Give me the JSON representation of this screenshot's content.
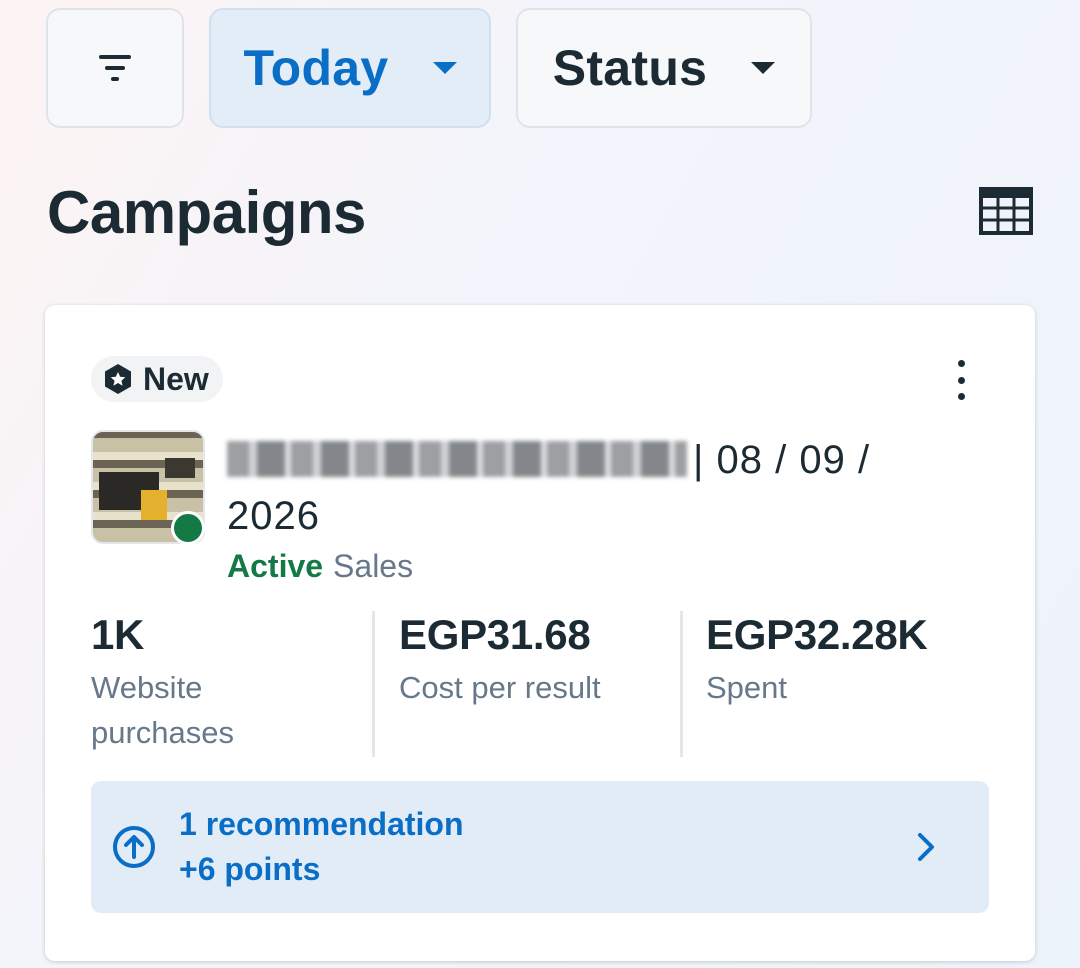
{
  "filters": {
    "date_label": "Today",
    "status_label": "Status"
  },
  "page": {
    "title": "Campaigns"
  },
  "campaign": {
    "badge": "New",
    "name_visible": "| 08 / 09 / 2026",
    "status": "Active",
    "type": "Sales",
    "metrics": [
      {
        "value": "1K",
        "label": "Website purchases"
      },
      {
        "value": "EGP31.68",
        "label": "Cost per result"
      },
      {
        "value": "EGP32.28K",
        "label": "Spent"
      }
    ],
    "recommendation": {
      "title": "1 recommendation",
      "points": "+6 points"
    }
  },
  "icons": {
    "filter": "filter-icon",
    "table": "table-view-icon",
    "badge": "new-badge-icon",
    "more": "more-vertical-icon",
    "recommendation": "arrow-up-circle-icon",
    "chevron": "chevron-right-icon"
  },
  "colors": {
    "accent": "#0a6ec6",
    "active": "#137a45",
    "text": "#1c2b33",
    "muted": "#67788a"
  }
}
